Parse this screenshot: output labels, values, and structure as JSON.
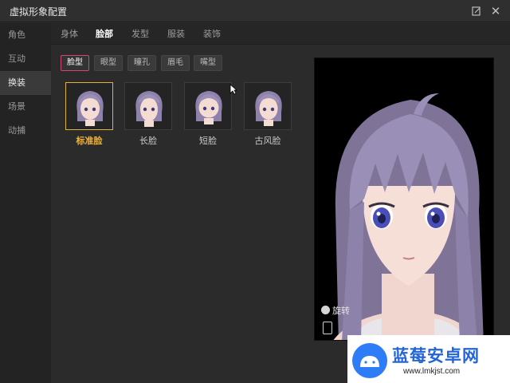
{
  "window": {
    "title": "虚拟形象配置"
  },
  "sidebar": {
    "items": [
      {
        "label": "角色"
      },
      {
        "label": "互动"
      },
      {
        "label": "换装"
      },
      {
        "label": "场景"
      },
      {
        "label": "动捕"
      }
    ],
    "active_index": 2
  },
  "tabs": {
    "items": [
      {
        "label": "身体"
      },
      {
        "label": "脸部"
      },
      {
        "label": "发型"
      },
      {
        "label": "服装"
      },
      {
        "label": "装饰"
      }
    ],
    "active_index": 1
  },
  "subtabs": {
    "items": [
      {
        "label": "脸型"
      },
      {
        "label": "眼型"
      },
      {
        "label": "瞳孔"
      },
      {
        "label": "眉毛"
      },
      {
        "label": "嘴型"
      }
    ],
    "active_index": 0
  },
  "face_options": [
    {
      "label": "标准脸",
      "selected": true
    },
    {
      "label": "长脸",
      "selected": false
    },
    {
      "label": "短脸",
      "selected": false
    },
    {
      "label": "古风脸",
      "selected": false
    }
  ],
  "preview": {
    "rotate_label": "旋转"
  },
  "watermark": {
    "brand": "蓝莓安卓网",
    "url": "www.lmkjst.com"
  },
  "colors": {
    "accent_selected": "#e2b33b",
    "subtab_active_border": "#d5476a",
    "hair": "#9a8fb6"
  }
}
